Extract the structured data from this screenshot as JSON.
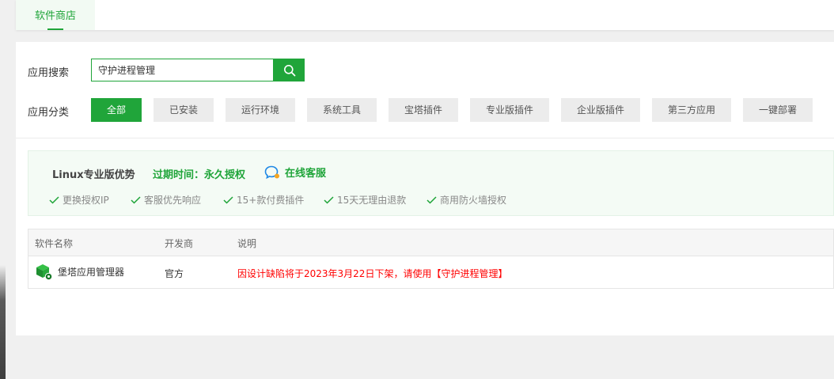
{
  "top_tabs": [
    {
      "label": "软件商店"
    }
  ],
  "search": {
    "label": "应用搜索",
    "value": "守护进程管理"
  },
  "categories": {
    "label": "应用分类",
    "items": [
      "全部",
      "已安装",
      "运行环境",
      "系统工具",
      "宝塔插件",
      "专业版插件",
      "企业版插件",
      "第三方应用",
      "一键部署"
    ],
    "active_index": 0
  },
  "promo": {
    "title": "Linux专业版优势",
    "expire_label": "过期时间：",
    "expire_value": "永久授权",
    "service_label": "在线客服",
    "features": [
      "更换授权IP",
      "客服优先响应",
      "15+款付费插件",
      "15天无理由退款",
      "商用防火墙授权"
    ]
  },
  "table": {
    "headers": [
      "软件名称",
      "开发商",
      "说明"
    ],
    "rows": [
      {
        "name": "堡塔应用管理器",
        "developer": "官方",
        "description": "因设计缺陷将于2023年3月22日下架，请使用【守护进程管理】"
      }
    ]
  },
  "colors": {
    "accent": "#20a53a",
    "warning": "#ff0000",
    "text": "#333333",
    "muted": "#888888"
  },
  "icons": {
    "search": "search-icon",
    "service": "chat-bubble-icon",
    "check": "check-icon",
    "app": "green-cube-icon"
  }
}
